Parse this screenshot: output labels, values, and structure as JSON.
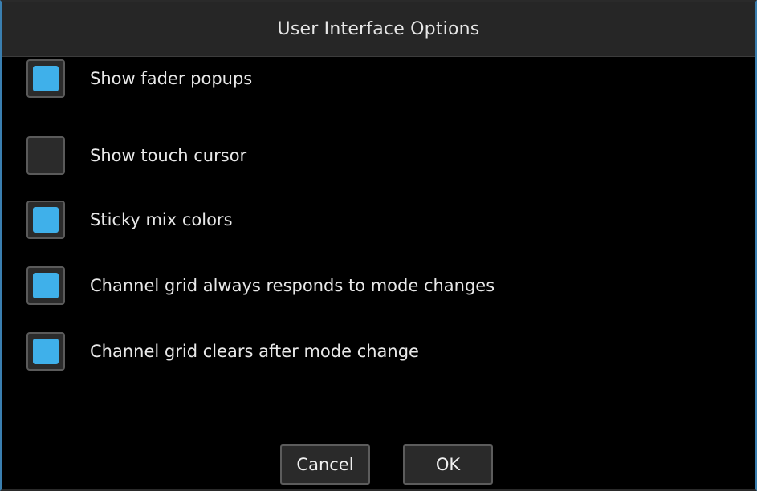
{
  "dialog": {
    "title": "User Interface Options"
  },
  "options": [
    {
      "label": "Show fader popups",
      "checked": true
    },
    {
      "label": "Show touch cursor",
      "checked": false
    },
    {
      "label": "Sticky mix colors",
      "checked": true
    },
    {
      "label": "Channel grid always responds to mode changes",
      "checked": true
    },
    {
      "label": "Channel grid clears after mode change",
      "checked": true
    }
  ],
  "buttons": {
    "cancel_label": "Cancel",
    "ok_label": "OK"
  },
  "colors": {
    "checked_fill": "#3fb0ea",
    "background": "#000000",
    "titlebar": "#262626"
  }
}
